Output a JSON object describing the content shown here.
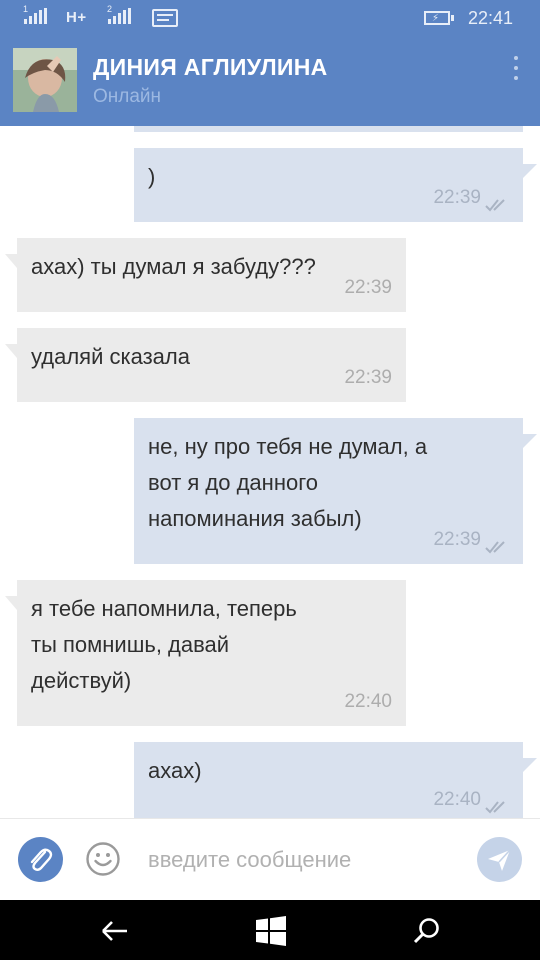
{
  "status_bar": {
    "network_type": "H+",
    "sim2_label": "2",
    "time": "22:41"
  },
  "header": {
    "contact_name": "ДИНИЯ АГЛИУЛИНА",
    "contact_status": "Онлайн"
  },
  "messages": [
    {
      "direction": "out",
      "text": ")",
      "time": "22:39",
      "read": true
    },
    {
      "direction": "in",
      "text": "ахах) ты думал я забуду???",
      "time": "22:39"
    },
    {
      "direction": "in",
      "text": "удаляй сказала",
      "time": "22:39"
    },
    {
      "direction": "out",
      "text": "не, ну про тебя не думал, а\nвот я до данного\nнапоминания забыл)",
      "time": "22:39",
      "read": true
    },
    {
      "direction": "in",
      "text": "я тебе напомнила, теперь\nты помнишь, давай\nдействуй)",
      "time": "22:40"
    },
    {
      "direction": "out",
      "text": "ахах)",
      "time": "22:40",
      "read": true
    }
  ],
  "compose": {
    "placeholder": "введите сообщение"
  },
  "colors": {
    "header": "#5b84c4",
    "incoming_bubble": "#ebebeb",
    "outgoing_bubble": "#d9e1ee",
    "send_button": "#c5d3e8"
  },
  "icons": {
    "attach": "paperclip-icon",
    "emoji": "smiley-icon",
    "send": "paper-plane-icon",
    "back": "back-arrow-icon",
    "start": "windows-logo-icon",
    "search": "search-icon"
  }
}
